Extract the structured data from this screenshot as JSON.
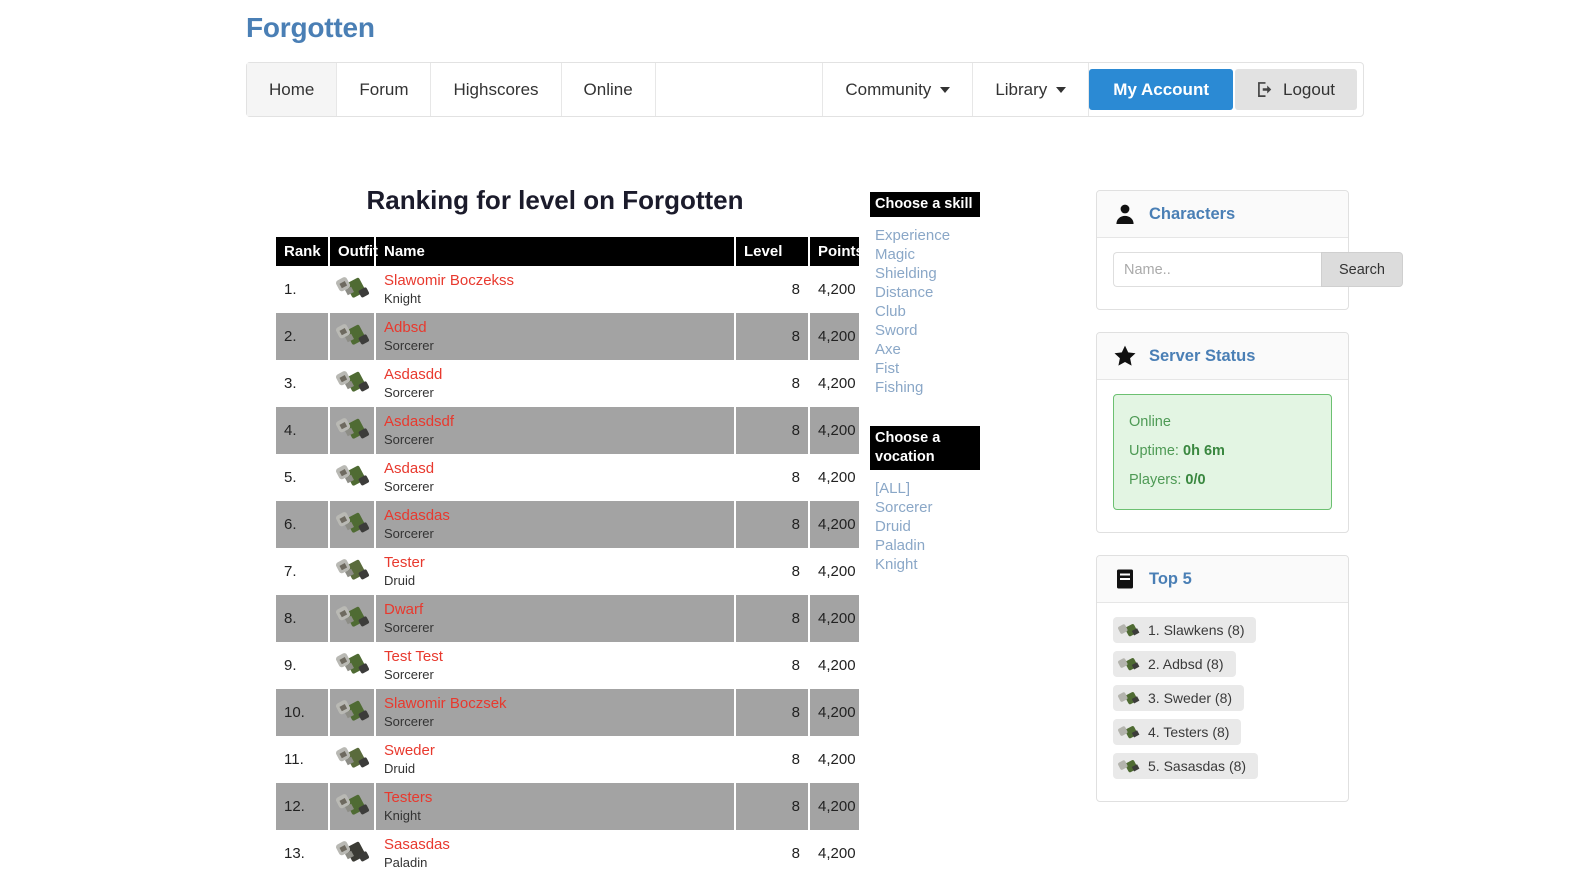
{
  "brand": {
    "name": "Forgotten"
  },
  "nav": {
    "items": [
      {
        "label": "Home",
        "active": true
      },
      {
        "label": "Forum",
        "active": false
      },
      {
        "label": "Highscores",
        "active": false
      },
      {
        "label": "Online",
        "active": false
      }
    ],
    "dropdowns": [
      {
        "label": "Community"
      },
      {
        "label": "Library"
      }
    ],
    "account_label": "My Account",
    "logout_label": "Logout",
    "logout_icon": "logout-icon",
    "caret_icon": "chevron-down-icon"
  },
  "ranking": {
    "title": "Ranking for level on Forgotten",
    "columns": [
      "Rank",
      "Outfit",
      "Name",
      "Level",
      "Points"
    ],
    "rows": [
      {
        "rank": "1.",
        "name": "Slawomir Boczekss",
        "vocation": "Knight",
        "level": "8",
        "points": "4,200"
      },
      {
        "rank": "2.",
        "name": "Adbsd",
        "vocation": "Sorcerer",
        "level": "8",
        "points": "4,200"
      },
      {
        "rank": "3.",
        "name": "Asdasdd",
        "vocation": "Sorcerer",
        "level": "8",
        "points": "4,200"
      },
      {
        "rank": "4.",
        "name": "Asdasdsdf",
        "vocation": "Sorcerer",
        "level": "8",
        "points": "4,200"
      },
      {
        "rank": "5.",
        "name": "Asdasd",
        "vocation": "Sorcerer",
        "level": "8",
        "points": "4,200"
      },
      {
        "rank": "6.",
        "name": "Asdasdas",
        "vocation": "Sorcerer",
        "level": "8",
        "points": "4,200"
      },
      {
        "rank": "7.",
        "name": "Tester",
        "vocation": "Druid",
        "level": "8",
        "points": "4,200"
      },
      {
        "rank": "8.",
        "name": "Dwarf",
        "vocation": "Sorcerer",
        "level": "8",
        "points": "4,200"
      },
      {
        "rank": "9.",
        "name": "Test Test",
        "vocation": "Sorcerer",
        "level": "8",
        "points": "4,200"
      },
      {
        "rank": "10.",
        "name": "Slawomir Boczsek",
        "vocation": "Sorcerer",
        "level": "8",
        "points": "4,200"
      },
      {
        "rank": "11.",
        "name": "Sweder",
        "vocation": "Druid",
        "level": "8",
        "points": "4,200"
      },
      {
        "rank": "12.",
        "name": "Testers",
        "vocation": "Knight",
        "level": "8",
        "points": "4,200"
      },
      {
        "rank": "13.",
        "name": "Sasasdas",
        "vocation": "Paladin",
        "level": "8",
        "points": "4,200"
      }
    ]
  },
  "filters": {
    "skill_header": "Choose a skill",
    "skills": [
      "Experience",
      "Magic",
      "Shielding",
      "Distance",
      "Club",
      "Sword",
      "Axe",
      "Fist",
      "Fishing"
    ],
    "vocation_header": "Choose a vocation",
    "vocations": [
      "[ALL]",
      "Sorcerer",
      "Druid",
      "Paladin",
      "Knight"
    ]
  },
  "sidebar": {
    "characters": {
      "title": "Characters",
      "icon": "user-icon",
      "search_placeholder": "Name..",
      "search_value": "",
      "search_button": "Search"
    },
    "server_status": {
      "title": "Server Status",
      "icon": "star-icon",
      "state": "Online",
      "uptime_label": "Uptime:",
      "uptime_value": "0h 6m",
      "players_label": "Players:",
      "players_value": "0/0"
    },
    "top5": {
      "title": "Top 5",
      "icon": "book-icon",
      "items": [
        {
          "label": "1. Slawkens (8)"
        },
        {
          "label": "2. Adbsd (8)"
        },
        {
          "label": "3. Sweder (8)"
        },
        {
          "label": "4. Testers (8)"
        },
        {
          "label": "5. Sasasdas (8)"
        }
      ]
    }
  },
  "colors": {
    "brand": "#4a7fb5",
    "accent_button": "#2b8ad4",
    "name_link": "#e8392e",
    "filter_link": "#8aa7c7",
    "row_alt": "#a3a3a3",
    "status_green": "#4e9a55",
    "header_black": "#000000"
  }
}
